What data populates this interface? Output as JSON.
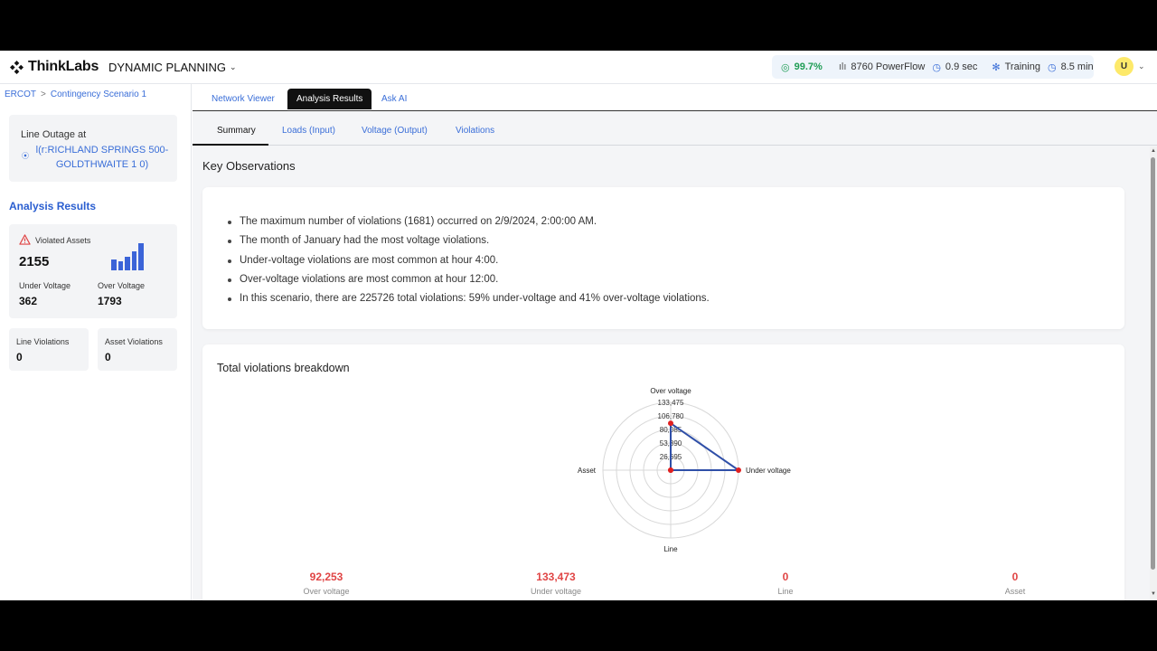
{
  "app": {
    "brand": "ThinkLabs",
    "product": "DYNAMIC PLANNING"
  },
  "header_stats": {
    "accuracy": "99.7%",
    "powerflow_label": "8760 PowerFlow",
    "powerflow_time": "0.9 sec",
    "training_label": "Training",
    "training_time": "8.5 min"
  },
  "user": {
    "initial": "U"
  },
  "breadcrumb": [
    "ERCOT",
    "Contingency Scenario 1"
  ],
  "outage": {
    "title": "Line Outage at",
    "link": "l(r:RICHLAND SPRINGS 500-GOLDTHWAITE 1 0)"
  },
  "sidebar": {
    "heading": "Analysis Results",
    "violated_assets": {
      "label": "Violated Assets",
      "value": "2155",
      "under_label": "Under Voltage",
      "under_value": "362",
      "over_label": "Over Voltage",
      "over_value": "1793"
    },
    "line_violations": {
      "label": "Line Violations",
      "value": "0"
    },
    "asset_violations": {
      "label": "Asset Violations",
      "value": "0"
    }
  },
  "tabs": [
    "Network Viewer",
    "Analysis Results",
    "Ask AI"
  ],
  "subtabs": [
    "Summary",
    "Loads (Input)",
    "Voltage (Output)",
    "Violations"
  ],
  "key_observations": {
    "title": "Key Observations",
    "items": [
      "The maximum number of violations (1681) occurred on 2/9/2024, 2:00:00 AM.",
      "The month of January had the most voltage violations.",
      "Under-voltage violations are most common at hour 4:00.",
      "Over-voltage violations are most common at hour 12:00.",
      "In this scenario, there are 225726 total violations: 59% under-voltage and 41% over-voltage violations."
    ]
  },
  "breakdown": {
    "title": "Total violations breakdown",
    "totals": [
      {
        "value": "92,253",
        "label": "Over voltage"
      },
      {
        "value": "133,473",
        "label": "Under voltage"
      },
      {
        "value": "0",
        "label": "Line"
      },
      {
        "value": "0",
        "label": "Asset"
      }
    ]
  },
  "chart_data": {
    "type": "radar",
    "title": "Total violations breakdown",
    "axes": [
      "Over voltage",
      "Under voltage",
      "Line",
      "Asset"
    ],
    "values": [
      92253,
      133473,
      0,
      0
    ],
    "ring_labels": [
      "26,695",
      "53,390",
      "80,085",
      "106,780",
      "133,475"
    ],
    "rmax": 133475,
    "grid": true,
    "line_color": "#2f4fa8",
    "point_color": "#e02020"
  },
  "colors": {
    "accent": "#3a6ed8",
    "heading": "#2a5ed0",
    "total_red": "#e04545",
    "bars": "#3b64d8",
    "accuracy_green": "#1f9d55"
  },
  "sidebar_mini_chart": {
    "values": [
      0.4,
      0.33,
      0.5,
      0.7,
      1.0
    ]
  }
}
